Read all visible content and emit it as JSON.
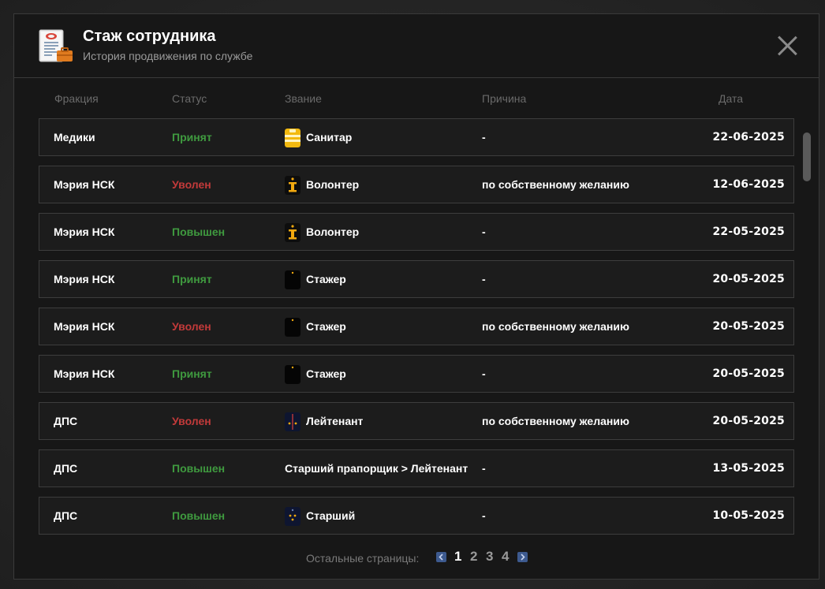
{
  "header": {
    "title": "Стаж сотрудника",
    "subtitle": "История продвижения по службе",
    "icon": "document-briefcase-icon",
    "close_icon": "close-icon"
  },
  "columns": [
    "Фракция",
    "Статус",
    "Звание",
    "Причина",
    "Дата"
  ],
  "colors": {
    "accepted": "#3f9a3f",
    "fired": "#c23a3a",
    "promoted": "#3f9a3f",
    "pager_accent": "#3d5a8f"
  },
  "rows": [
    {
      "faction": "Медики",
      "status": "Принят",
      "status_type": "accepted",
      "rank": "Санитар",
      "rank_icon": "medic-rank-icon",
      "reason": "-",
      "date": "22-06-2025"
    },
    {
      "faction": "Мэрия НСК",
      "status": "Уволен",
      "status_type": "fired",
      "rank": "Волонтер",
      "rank_icon": "volunteer-rank-icon",
      "reason": "по собственному желанию",
      "date": "12-06-2025"
    },
    {
      "faction": "Мэрия НСК",
      "status": "Повышен",
      "status_type": "promoted",
      "rank": "Волонтер",
      "rank_icon": "volunteer-rank-icon",
      "reason": "-",
      "date": "22-05-2025"
    },
    {
      "faction": "Мэрия НСК",
      "status": "Принят",
      "status_type": "accepted",
      "rank": "Стажер",
      "rank_icon": "intern-rank-icon",
      "reason": "-",
      "date": "20-05-2025"
    },
    {
      "faction": "Мэрия НСК",
      "status": "Уволен",
      "status_type": "fired",
      "rank": "Стажер",
      "rank_icon": "intern-rank-icon",
      "reason": "по собственному желанию",
      "date": "20-05-2025"
    },
    {
      "faction": "Мэрия НСК",
      "status": "Принят",
      "status_type": "accepted",
      "rank": "Стажер",
      "rank_icon": "intern-rank-icon",
      "reason": "-",
      "date": "20-05-2025"
    },
    {
      "faction": "ДПС",
      "status": "Уволен",
      "status_type": "fired",
      "rank": "Лейтенант",
      "rank_icon": "lieutenant-rank-icon",
      "reason": "по собственному желанию",
      "date": "20-05-2025"
    },
    {
      "faction": "ДПС",
      "status": "Повышен",
      "status_type": "promoted",
      "rank": "Старший прапорщик > Лейтенант",
      "rank_icon": "",
      "reason": "-",
      "date": "13-05-2025"
    },
    {
      "faction": "ДПС",
      "status": "Повышен",
      "status_type": "promoted",
      "rank": "Старший",
      "rank_icon": "senior-rank-icon",
      "reason": "-",
      "date": "10-05-2025"
    }
  ],
  "pager": {
    "label": "Остальные страницы:",
    "pages": [
      "1",
      "2",
      "3",
      "4"
    ],
    "current": "1",
    "prev_icon": "chevron-left-icon",
    "next_icon": "chevron-right-icon"
  }
}
